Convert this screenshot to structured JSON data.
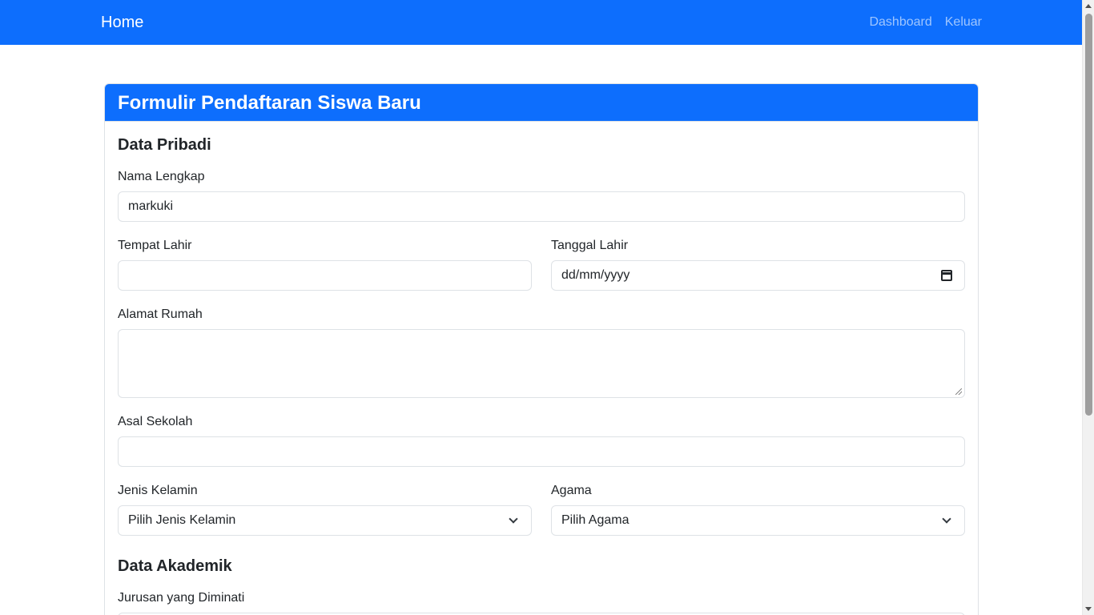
{
  "navbar": {
    "brand": "Home",
    "links": [
      "Dashboard",
      "Keluar"
    ]
  },
  "card": {
    "title": "Formulir Pendaftaran Siswa Baru"
  },
  "sections": {
    "personal": "Data Pribadi",
    "academic": "Data Akademik"
  },
  "fields": {
    "nama_lengkap": {
      "label": "Nama Lengkap",
      "value": "markuki"
    },
    "tempat_lahir": {
      "label": "Tempat Lahir",
      "value": ""
    },
    "tanggal_lahir": {
      "label": "Tanggal Lahir",
      "value": "dd/mm/yyyy"
    },
    "alamat_rumah": {
      "label": "Alamat Rumah",
      "value": ""
    },
    "asal_sekolah": {
      "label": "Asal Sekolah",
      "value": ""
    },
    "jenis_kelamin": {
      "label": "Jenis Kelamin",
      "selected": "Pilih Jenis Kelamin"
    },
    "agama": {
      "label": "Agama",
      "selected": "Pilih Agama"
    },
    "jurusan": {
      "label": "Jurusan yang Diminati"
    }
  },
  "colors": {
    "primary": "#0d6efd",
    "text": "#212529",
    "border": "#dee2e6"
  }
}
